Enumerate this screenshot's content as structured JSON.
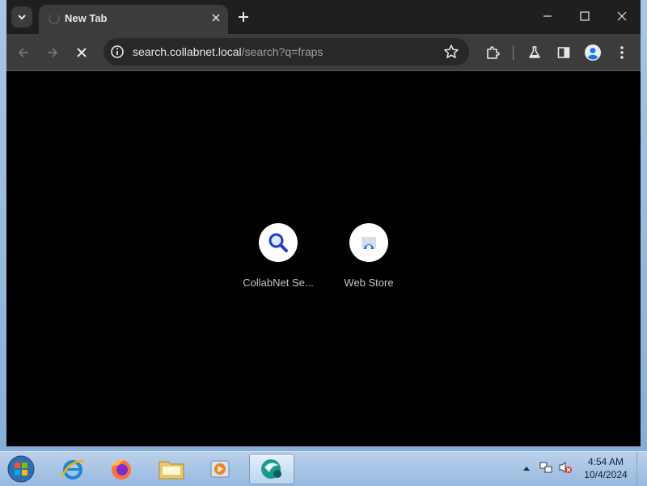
{
  "tab": {
    "title": "New Tab"
  },
  "omnibox": {
    "host": "search.collabnet.local",
    "path": "/search?q=fraps"
  },
  "shortcuts": [
    {
      "label": "CollabNet Se...",
      "icon": "search-magnifier-icon"
    },
    {
      "label": "Web Store",
      "icon": "web-store-icon"
    }
  ],
  "taskbar": {
    "apps": [
      "internet-explorer",
      "firefox",
      "file-explorer",
      "media-player",
      "active-app"
    ],
    "time": "4:54 AM",
    "date": "10/4/2024"
  },
  "colors": {
    "accent_blue": "#1a73e8",
    "content_bg": "#000000",
    "toolbar_bg": "#3c3c3c"
  }
}
